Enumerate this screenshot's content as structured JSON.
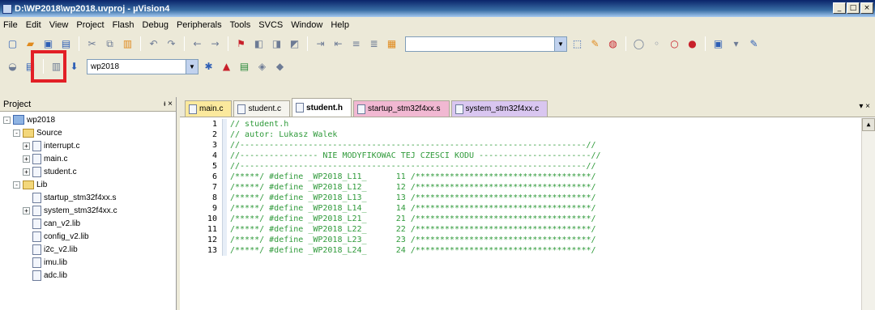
{
  "window": {
    "title": "D:\\WP2018\\wp2018.uvproj - µVision4",
    "minimize": "_",
    "maximize": "□",
    "close": "×"
  },
  "menu": [
    "File",
    "Edit",
    "View",
    "Project",
    "Flash",
    "Debug",
    "Peripherals",
    "Tools",
    "SVCS",
    "Window",
    "Help"
  ],
  "toolbar": {
    "target_value": "wp2018"
  },
  "project": {
    "header": "Project",
    "header_controls": "ᵻ ×",
    "tree": [
      {
        "label": "wp2018",
        "type": "root",
        "expander": "-"
      },
      {
        "label": "Source",
        "type": "folder",
        "expander": "-"
      },
      {
        "label": "interrupt.c",
        "type": "file",
        "expander": "+"
      },
      {
        "label": "main.c",
        "type": "file",
        "expander": "+"
      },
      {
        "label": "student.c",
        "type": "file",
        "expander": "+"
      },
      {
        "label": "Lib",
        "type": "folder",
        "expander": "-"
      },
      {
        "label": "startup_stm32f4xx.s",
        "type": "file",
        "expander": ""
      },
      {
        "label": "system_stm32f4xx.c",
        "type": "file",
        "expander": "+"
      },
      {
        "label": "can_v2.lib",
        "type": "file",
        "expander": ""
      },
      {
        "label": "config_v2.lib",
        "type": "file",
        "expander": ""
      },
      {
        "label": "i2c_v2.lib",
        "type": "file",
        "expander": ""
      },
      {
        "label": "imu.lib",
        "type": "file",
        "expander": ""
      },
      {
        "label": "adc.lib",
        "type": "file",
        "expander": ""
      }
    ]
  },
  "editor": {
    "tabs": [
      {
        "label": "main.c",
        "style": "yellow"
      },
      {
        "label": "student.c",
        "style": "gray"
      },
      {
        "label": "student.h",
        "style": "active"
      },
      {
        "label": "startup_stm32f4xx.s",
        "style": "pink"
      },
      {
        "label": "system_stm32f4xx.c",
        "style": "lilac"
      }
    ],
    "tabs_close": "▾ ×",
    "lines": [
      {
        "n": "1",
        "text": "// student.h"
      },
      {
        "n": "2",
        "text": "// autor: Lukasz Walek"
      },
      {
        "n": "3",
        "text": "//-----------------------------------------------------------------------//"
      },
      {
        "n": "4",
        "text": "//---------------- NIE MODYFIKOWAC TEJ CZESCI KODU -----------------------//"
      },
      {
        "n": "5",
        "text": "//-----------------------------------------------------------------------//"
      },
      {
        "n": "6",
        "text": "/*****/ #define _WP2018_L11_      11 /************************************/"
      },
      {
        "n": "7",
        "text": "/*****/ #define _WP2018_L12_      12 /************************************/"
      },
      {
        "n": "8",
        "text": "/*****/ #define _WP2018_L13_      13 /************************************/"
      },
      {
        "n": "9",
        "text": "/*****/ #define _WP2018_L14_      14 /************************************/"
      },
      {
        "n": "10",
        "text": "/*****/ #define _WP2018_L21_      21 /************************************/"
      },
      {
        "n": "11",
        "text": "/*****/ #define _WP2018_L22_      22 /************************************/"
      },
      {
        "n": "12",
        "text": "/*****/ #define _WP2018_L23_      23 /************************************/"
      },
      {
        "n": "13",
        "text": "/*****/ #define _WP2018_L24_      24 /************************************/"
      }
    ]
  },
  "colors": {
    "highlight": "#e21f26",
    "code_comment": "#2f9a3a"
  }
}
